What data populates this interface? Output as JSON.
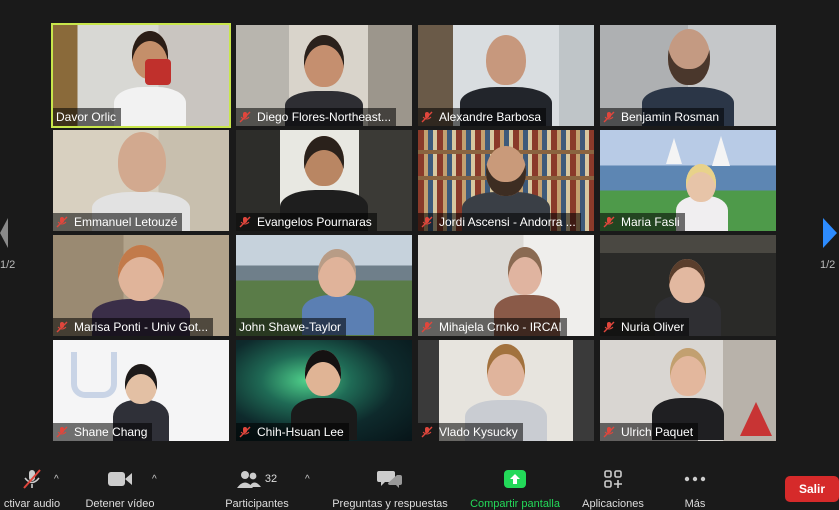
{
  "participants": [
    {
      "name": "Davor Orlic",
      "muted": false,
      "active": true
    },
    {
      "name": "Diego Flores-Northeast...",
      "muted": true
    },
    {
      "name": "Alexandre Barbosa",
      "muted": true
    },
    {
      "name": "Benjamin Rosman",
      "muted": true
    },
    {
      "name": "Emmanuel Letouzé",
      "muted": true
    },
    {
      "name": "Evangelos Pournaras",
      "muted": true
    },
    {
      "name": "Jordi Ascensi - Andorra ...",
      "muted": true
    },
    {
      "name": "Maria Fasli",
      "muted": true
    },
    {
      "name": "Marisa Ponti - Univ Got...",
      "muted": true
    },
    {
      "name": "John Shawe-Taylor",
      "muted": false
    },
    {
      "name": "Mihajela Crnko - IRCAI",
      "muted": true
    },
    {
      "name": "Nuria Oliver",
      "muted": true
    },
    {
      "name": "Shane Chang",
      "muted": true
    },
    {
      "name": "Chih-Hsuan Lee",
      "muted": true
    },
    {
      "name": "Vlado Kysucky",
      "muted": true
    },
    {
      "name": "Ulrich Paquet",
      "muted": true
    }
  ],
  "pagination": {
    "left": "1/2",
    "right": "1/2"
  },
  "toolbar": {
    "audio_label": "ctivar audio",
    "video_label": "Detener vídeo",
    "participants_label": "Participantes",
    "participants_count": "32",
    "qa_label": "Preguntas y respuestas",
    "share_label": "Compartir pantalla",
    "apps_label": "Aplicaciones",
    "more_label": "Más",
    "leave_label": "Salir"
  },
  "colors": {
    "active_outline": "#c8e64b",
    "mute_red": "#e0463c",
    "share_green": "#23d959",
    "leave_red": "#d62a2a",
    "nav_arrow": "#2d8cff"
  }
}
